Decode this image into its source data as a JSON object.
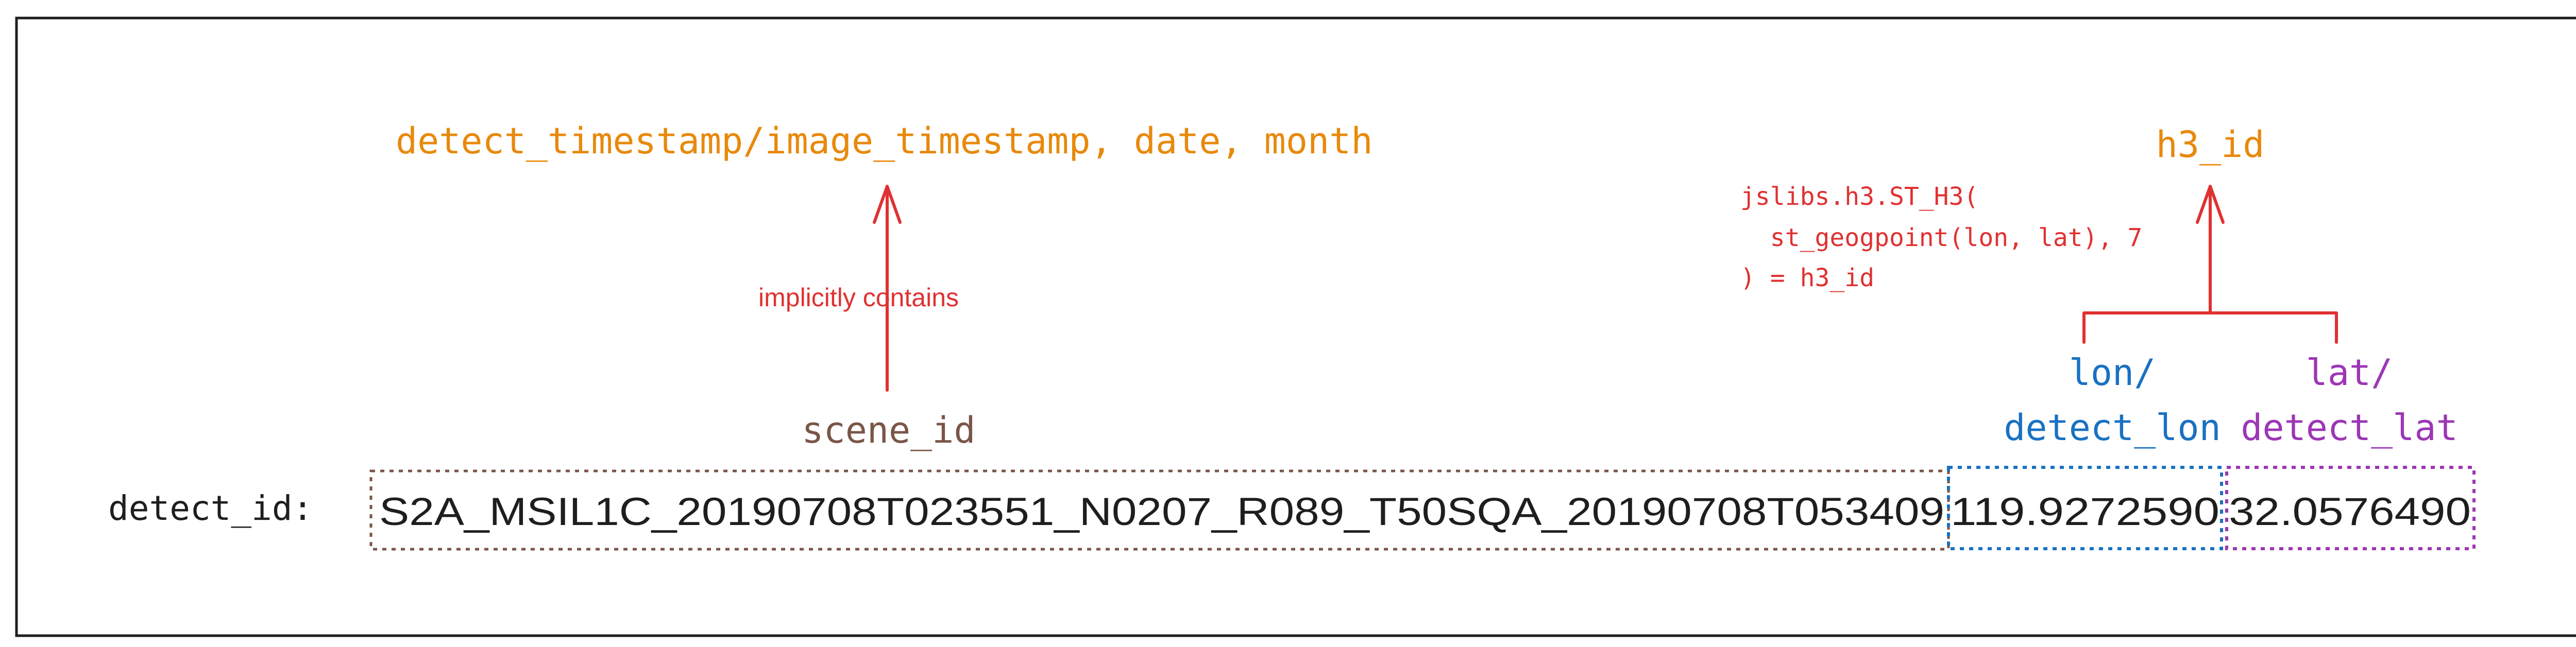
{
  "colors": {
    "orange": "#e8890c",
    "red": "#e03131",
    "brown": "#7a5548",
    "blue": "#1971c2",
    "purple": "#9c36b5",
    "black": "#1e1e1e",
    "frame": "#1e1e1e"
  },
  "labels": {
    "timestamp_fields": "detect_timestamp/image_timestamp, date, month",
    "h3_id": "h3_id",
    "implicit_note": "implicitly contains",
    "h3_code_line1": "jslibs.h3.ST_H3(",
    "h3_code_line2": "  st_geogpoint(lon, lat), 7",
    "h3_code_line3": ") = h3_id",
    "scene_id": "scene_id",
    "lon_line1": "lon/",
    "lon_line2": "detect_lon",
    "lat_line1": "lat/",
    "lat_line2": "detect_lat",
    "detect_id_label": "detect_id:"
  },
  "detect_id": {
    "scene_part": "S2A_MSIL1C_20190708T023551_N0207_R089_T50SQA_20190708T053409",
    "lon_part": "119.9272590",
    "lat_part": "32.0576490"
  }
}
